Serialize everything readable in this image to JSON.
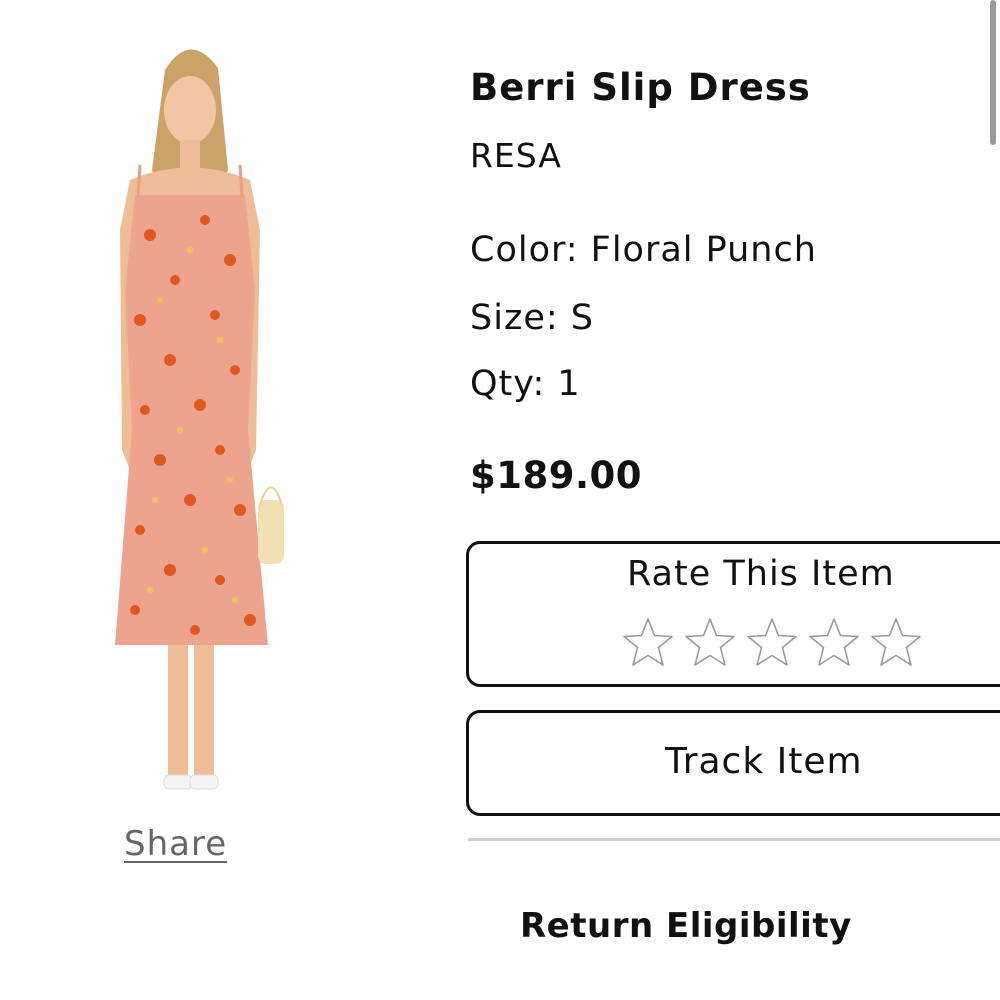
{
  "product": {
    "title": "Berri Slip Dress",
    "brand": "RESA",
    "color_label": "Color: Floral Punch",
    "size_label": "Size: S",
    "qty_label": "Qty: 1",
    "price": "$189.00",
    "image_icon": "product-photo"
  },
  "share": {
    "label": "Share"
  },
  "rating": {
    "title": "Rate This Item",
    "stars": 5,
    "current": 0,
    "star_icon": "star-outline-icon"
  },
  "track": {
    "label": "Track Item"
  },
  "returns": {
    "title": "Return Eligibility"
  },
  "colors": {
    "dress": "#eda48f",
    "flower": "#e2561f",
    "border": "#111111",
    "divider": "#cfcfcf",
    "share": "#666666"
  }
}
